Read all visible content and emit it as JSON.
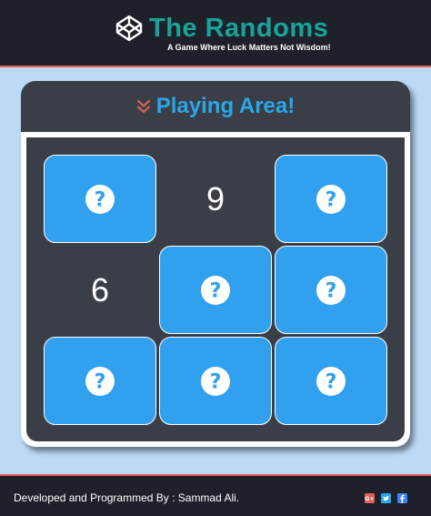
{
  "header": {
    "logo_icon": "codepen-icon",
    "title": "The Randoms",
    "tagline": "A Game Where Luck Matters Not Wisdom!"
  },
  "panel": {
    "icon": "double-chevron-down-icon",
    "title": "Playing Area!"
  },
  "board": {
    "cells": [
      {
        "state": "hidden",
        "icon": "question-circle-icon"
      },
      {
        "state": "revealed",
        "value": "9"
      },
      {
        "state": "hidden",
        "icon": "question-circle-icon"
      },
      {
        "state": "revealed",
        "value": "6"
      },
      {
        "state": "hidden",
        "icon": "question-circle-icon"
      },
      {
        "state": "hidden",
        "icon": "question-circle-icon"
      },
      {
        "state": "hidden",
        "icon": "question-circle-icon"
      },
      {
        "state": "hidden",
        "icon": "question-circle-icon"
      },
      {
        "state": "hidden",
        "icon": "question-circle-icon"
      }
    ]
  },
  "footer": {
    "credits": "Developed and Programmed By : Sammad Ali.",
    "social": [
      "google-plus-icon",
      "twitter-icon",
      "facebook-icon"
    ]
  },
  "colors": {
    "bar_bg": "#1e2129",
    "accent_line": "#e0605a",
    "brand_teal": "#1aa39a",
    "title_blue": "#2aa6ea",
    "tile_blue": "#30a0ef",
    "board_bg": "#3a3f47",
    "page_bg": "#bcd9f5"
  }
}
